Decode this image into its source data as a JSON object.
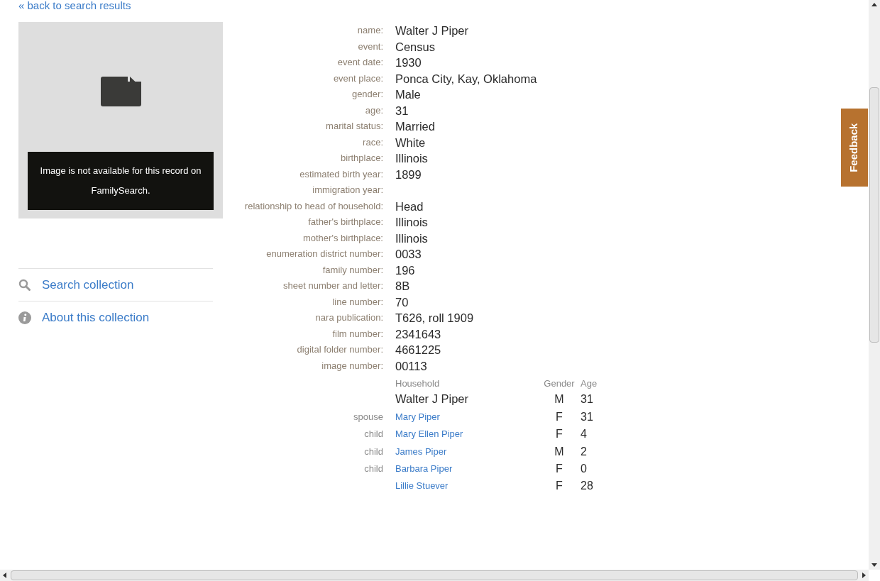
{
  "back_link": "« back to search results",
  "image_panel": {
    "message": "Image is not available for this record on FamilySearch."
  },
  "side_links": [
    {
      "kind": "search",
      "label": "Search collection"
    },
    {
      "kind": "info",
      "label": "About this collection"
    }
  ],
  "fields": [
    {
      "label": "name:",
      "value": "Walter J Piper"
    },
    {
      "label": "event:",
      "value": "Census"
    },
    {
      "label": "event date:",
      "value": "1930"
    },
    {
      "label": "event place:",
      "value": "Ponca City, Kay, Oklahoma"
    },
    {
      "label": "gender:",
      "value": "Male"
    },
    {
      "label": "age:",
      "value": "31"
    },
    {
      "label": "marital status:",
      "value": "Married"
    },
    {
      "label": "race:",
      "value": "White"
    },
    {
      "label": "birthplace:",
      "value": "Illinois"
    },
    {
      "label": "estimated birth year:",
      "value": "1899"
    },
    {
      "label": "immigration year:"
    },
    {
      "label": "relationship to head of household:",
      "value": "Head"
    },
    {
      "label": "father's birthplace:",
      "value": "Illinois"
    },
    {
      "label": "mother's birthplace:",
      "value": "Illinois"
    },
    {
      "label": "enumeration district number:",
      "value": "0033"
    },
    {
      "label": "family number:",
      "value": "196"
    },
    {
      "label": "sheet number and letter:",
      "value": "8B"
    },
    {
      "label": "line number:",
      "value": "70"
    },
    {
      "label": "nara publication:",
      "value": "T626, roll 1909"
    },
    {
      "label": "film number:",
      "value": "2341643"
    },
    {
      "label": "digital folder number:",
      "value": "4661225"
    },
    {
      "label": "image number:",
      "value": "00113"
    }
  ],
  "household": {
    "columns": [
      "Household",
      "Gender",
      "Age"
    ],
    "rows": [
      {
        "kind": "principal",
        "name": "Walter J Piper",
        "gender": "M",
        "age": "31"
      },
      {
        "kind": "link",
        "relationship": "spouse",
        "name": "Mary Piper",
        "gender": "F",
        "age": "31"
      },
      {
        "kind": "link",
        "relationship": "child",
        "name": "Mary Ellen Piper",
        "gender": "F",
        "age": "4"
      },
      {
        "kind": "link",
        "relationship": "child",
        "name": "James Piper",
        "gender": "M",
        "age": "2"
      },
      {
        "kind": "link",
        "relationship": "child",
        "name": "Barbara Piper",
        "gender": "F",
        "age": "0"
      },
      {
        "kind": "link",
        "name": "Lillie Stuever",
        "gender": "F",
        "age": "28"
      }
    ]
  },
  "feedback_tab": "Feedback"
}
